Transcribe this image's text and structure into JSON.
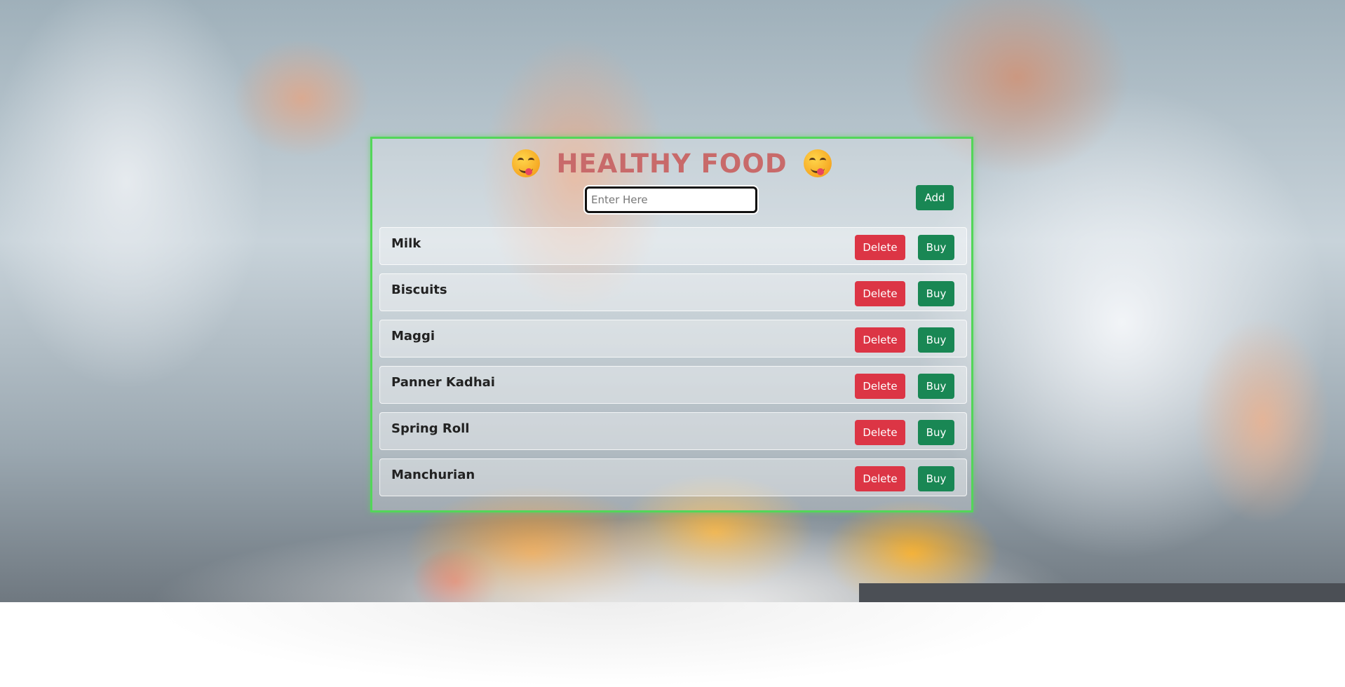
{
  "header": {
    "title": "HEALTHY FOOD",
    "left_icon": "yum-face-icon",
    "right_icon": "yum-face-icon"
  },
  "form": {
    "placeholder": "Enter Here",
    "value": "",
    "add_label": "Add"
  },
  "items": [
    {
      "label": "Milk",
      "delete_label": "Delete",
      "buy_label": "Buy"
    },
    {
      "label": "Biscuits",
      "delete_label": "Delete",
      "buy_label": "Buy"
    },
    {
      "label": "Maggi",
      "delete_label": "Delete",
      "buy_label": "Buy"
    },
    {
      "label": "Panner Kadhai",
      "delete_label": "Delete",
      "buy_label": "Buy"
    },
    {
      "label": "Spring Roll",
      "delete_label": "Delete",
      "buy_label": "Buy"
    },
    {
      "label": "Manchurian",
      "delete_label": "Delete",
      "buy_label": "Buy"
    }
  ],
  "colors": {
    "title": "#c86a6a",
    "panel_border": "#53d659",
    "delete": "#dc3545",
    "buy": "#198754",
    "add": "#198754"
  }
}
